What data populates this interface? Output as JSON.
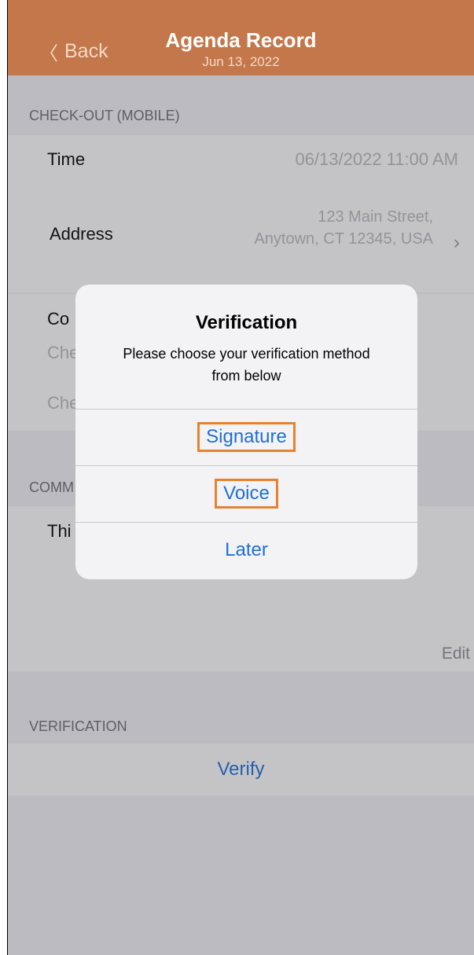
{
  "nav": {
    "back_label": "Back",
    "title": "Agenda Record",
    "subtitle": "Jun 13, 2022",
    "color": "#c4774a"
  },
  "checkout": {
    "header": "CHECK-OUT (MOBILE)",
    "time_label": "Time",
    "time_value": "06/13/2022 11:00 AM",
    "address_label": "Address",
    "address_line1": "123 Main Street,",
    "address_line2": "Anytown, CT 12345, USA"
  },
  "partial": {
    "con_label": "Co",
    "che1": "Che",
    "che2": "Che",
    "comm_header": "COMM",
    "thi_label": "Thi",
    "edit_label": "Edit"
  },
  "verification": {
    "header": "VERIFICATION",
    "verify_label": "Verify"
  },
  "alert": {
    "title": "Verification",
    "message": "Please choose your verification method from below",
    "actions": [
      "Signature",
      "Voice",
      "Later"
    ]
  },
  "colors": {
    "link_blue": "#1f6fd8",
    "highlight_orange": "#e8812e"
  }
}
